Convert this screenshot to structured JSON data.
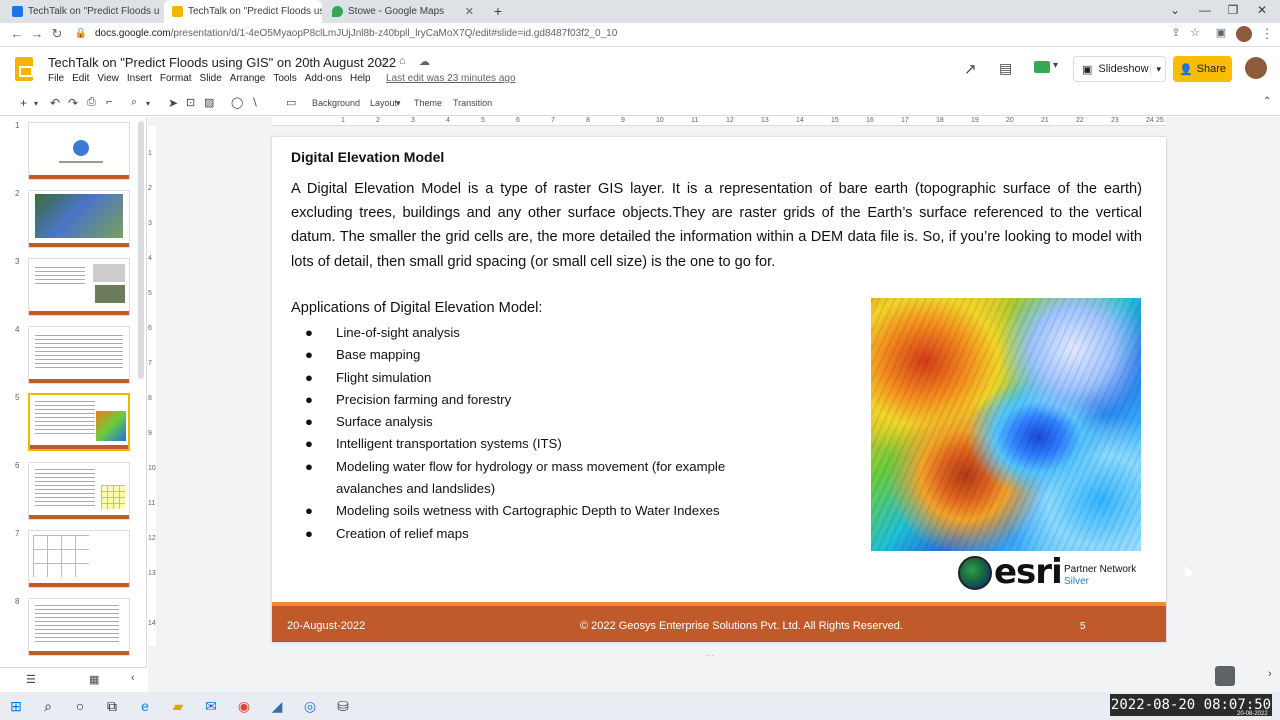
{
  "browser": {
    "tabs": [
      {
        "label": "TechTalk on \"Predict Floods u",
        "favicon_color": "#1a73e8"
      },
      {
        "label": "TechTalk on \"Predict Floods using",
        "favicon_color": "#f4b400"
      },
      {
        "label": "Stowe - Google Maps",
        "favicon_color": "#34a853"
      }
    ],
    "new_tab": "+",
    "url_host": "docs.google.com",
    "url_path": "/presentation/d/1-4eO5MyaopP8clLmJUjJnl8b-z40bpll_lryCaMoX7Q/edit#slide=id.gd8487f03f2_0_10"
  },
  "app": {
    "title": "TechTalk on \"Predict Floods using GIS\" on 20th August 2022",
    "menu": [
      "File",
      "Edit",
      "View",
      "Insert",
      "Format",
      "Slide",
      "Arrange",
      "Tools",
      "Add-ons",
      "Help"
    ],
    "last_edit": "Last edit was 23 minutes ago",
    "slideshow_label": "Slideshow",
    "share_label": "Share"
  },
  "toolbar": {
    "background_label": "Background",
    "layout_label": "Layout",
    "theme_label": "Theme",
    "transition_label": "Transition"
  },
  "filmstrip": {
    "slides": [
      "1",
      "2",
      "3",
      "4",
      "5",
      "6",
      "7",
      "8"
    ],
    "selected": "5"
  },
  "ruler": {
    "h_ticks": [
      "1",
      "2",
      "3",
      "4",
      "5",
      "6",
      "7",
      "8",
      "9",
      "10",
      "11",
      "12",
      "13",
      "14",
      "15",
      "16",
      "17",
      "18",
      "19",
      "20",
      "21",
      "22",
      "23",
      "24",
      "25"
    ],
    "v_ticks": [
      "1",
      "2",
      "3",
      "4",
      "5",
      "6",
      "7",
      "8",
      "9",
      "10",
      "11",
      "12",
      "13",
      "14"
    ]
  },
  "slide": {
    "title": "Digital Elevation Model",
    "paragraph": "A Digital Elevation Model is a type of raster GIS layer. It is a representation of bare earth (topographic surface of the earth) excluding trees, buildings and any other surface objects.They are raster grids of the Earth’s surface referenced to the vertical datum. The smaller the grid cells are, the more detailed the information within a DEM data file is. So, if you’re looking to model with lots of detail, then small grid spacing (or small cell size) is the one to go for.",
    "applications_title": "Applications of Digital Elevation Model:",
    "applications": [
      "Line-of-sight analysis",
      "Base mapping",
      "Flight simulation",
      "Precision farming and forestry",
      "Surface analysis",
      "Intelligent transportation systems (ITS)",
      "Modeling water flow for hydrology or mass movement (for example",
      "avalanches and landslides)",
      "Modeling soils wetness with Cartographic Depth to Water Indexes",
      "Creation of relief maps"
    ],
    "logo_word": "esri",
    "partner_line1": "Partner Network",
    "partner_line2": "Silver",
    "footer_date": "20-August-2022",
    "footer_copyright": "© 2022 Geosys Enterprise Solutions Pvt. Ltd. All Rights Reserved.",
    "footer_page": "5"
  },
  "taskbar": {
    "clock": "2022-08-20  08:07:50",
    "clock_small": "20-08-2022"
  },
  "colors": {
    "accent": "#f4b400",
    "footer": "#c05a2b",
    "footer_stripe": "#f08a3a"
  }
}
